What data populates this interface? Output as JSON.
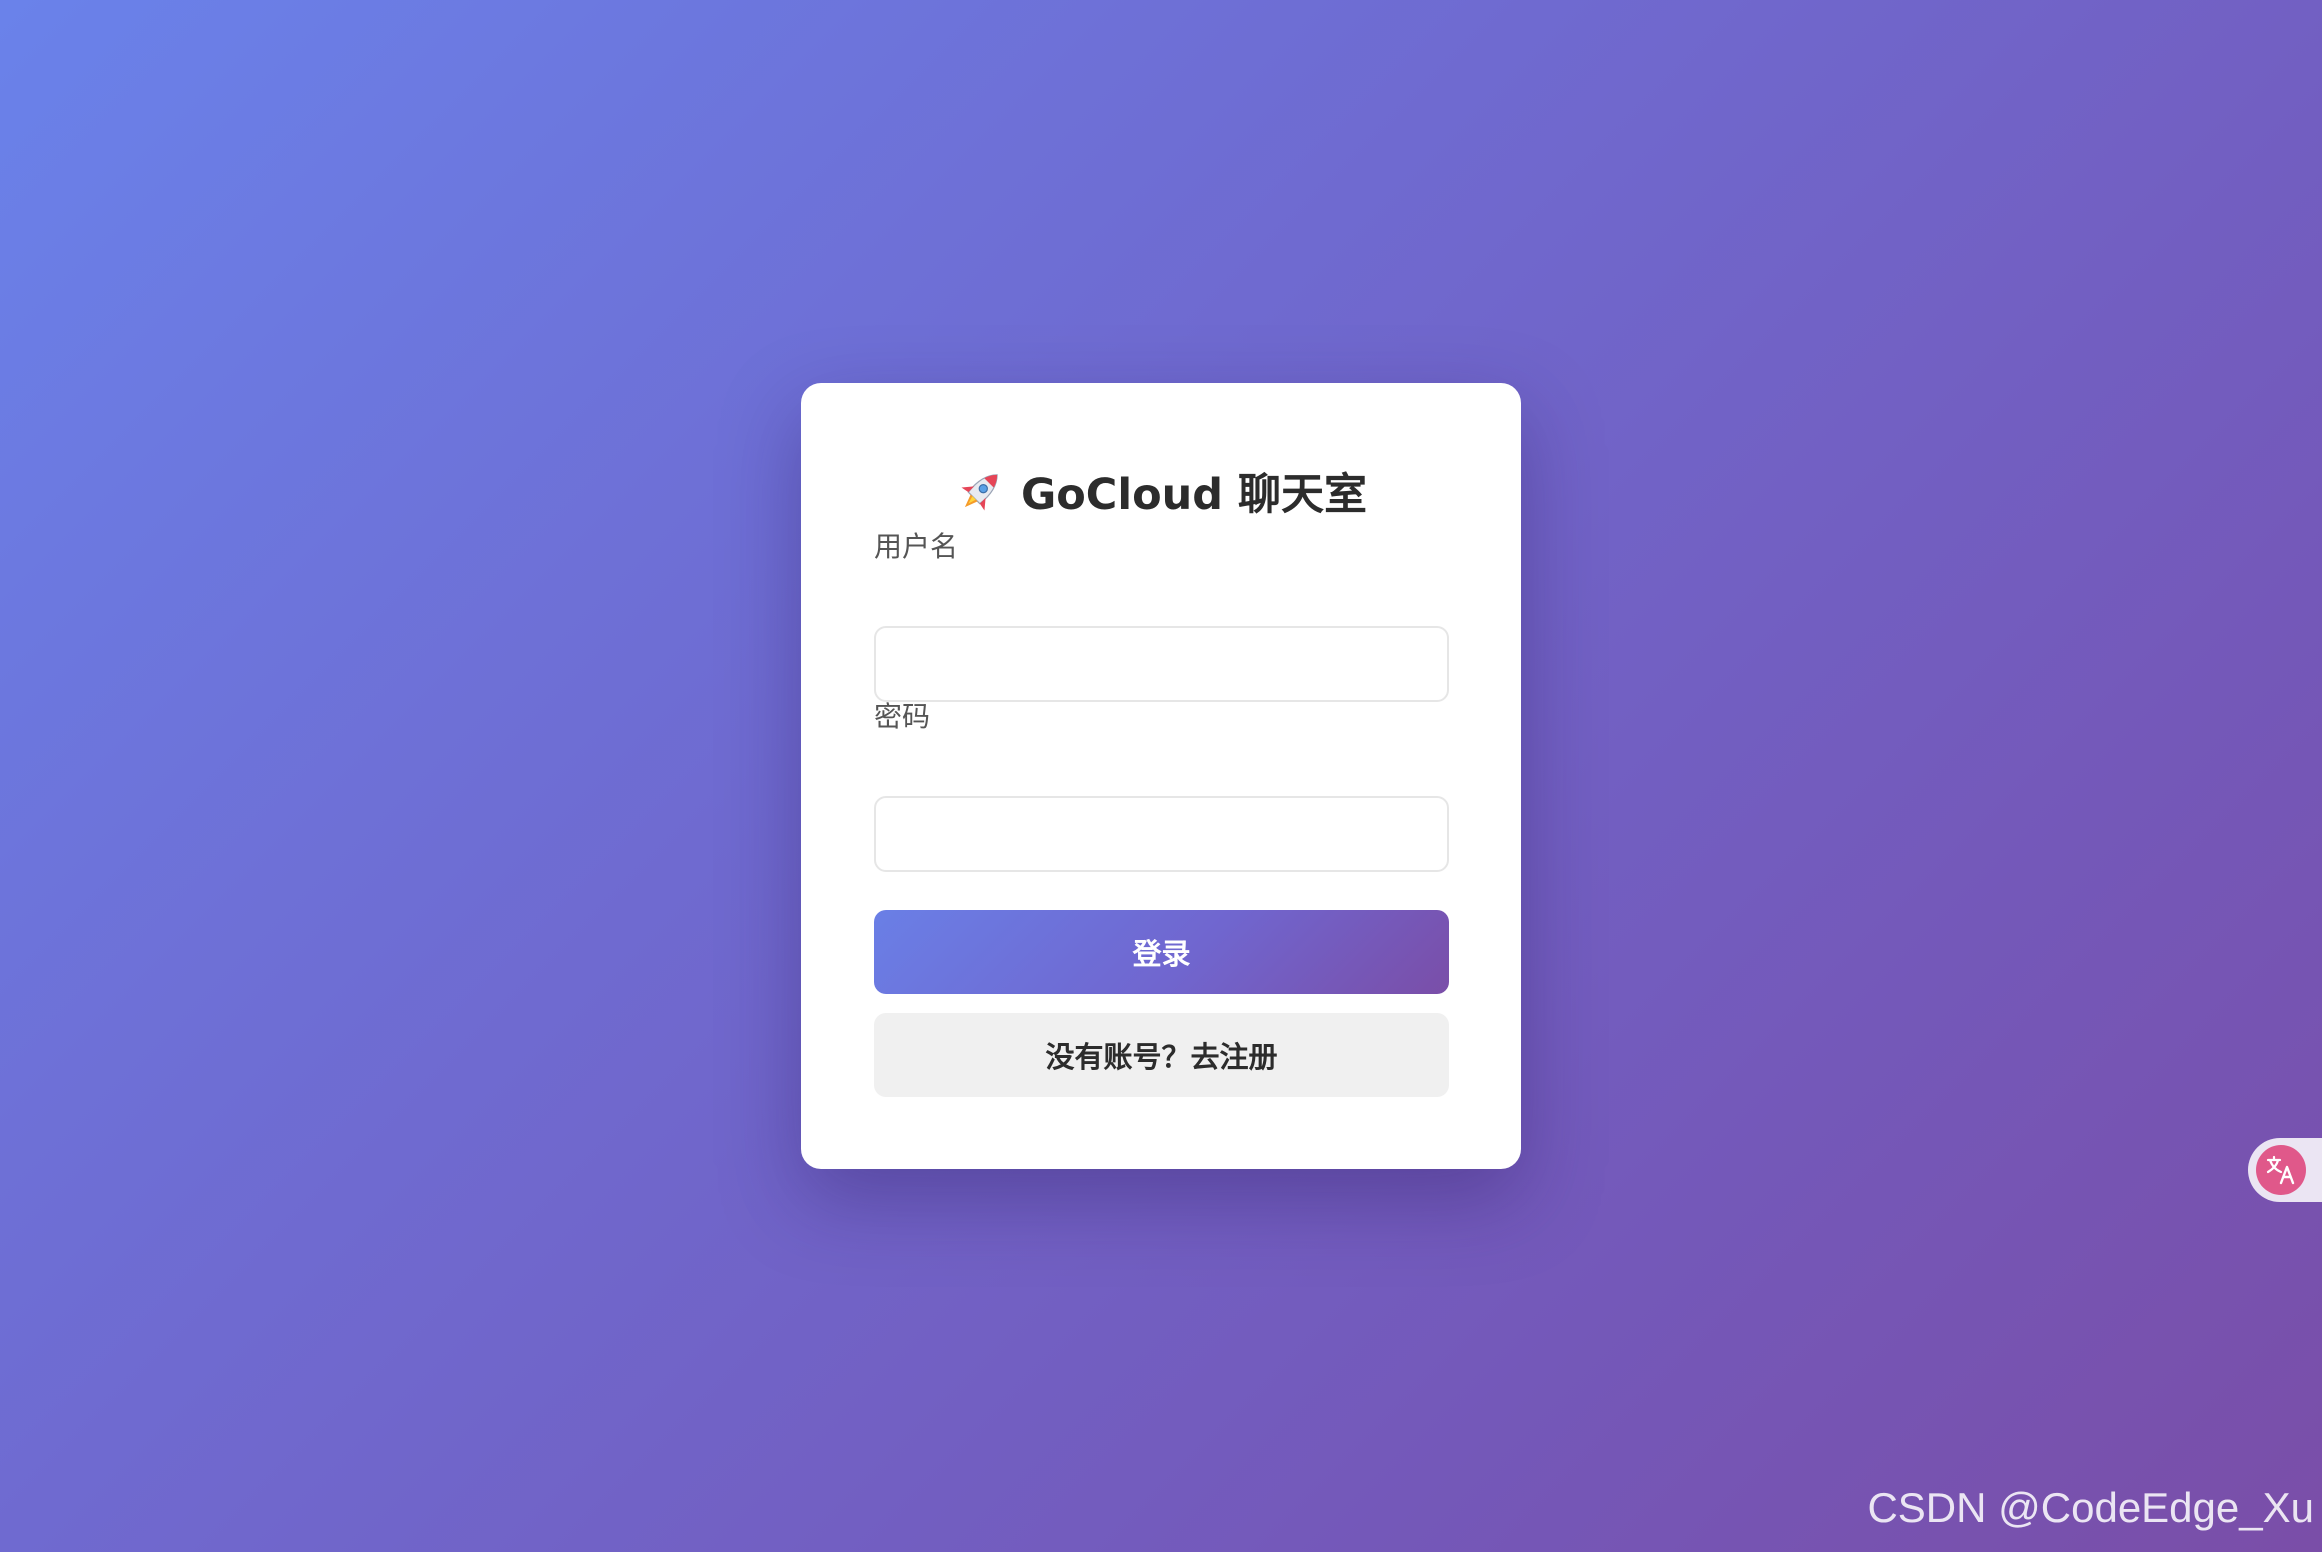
{
  "login_card": {
    "title": "GoCloud 聊天室",
    "title_icon": "rocket-icon",
    "username_label": "用户名",
    "username_value": "",
    "password_label": "密码",
    "password_value": "",
    "login_button": "登录",
    "register_button": "没有账号？去注册"
  },
  "translate_widget": {
    "icon": "translate-icon"
  },
  "watermark": "CSDN @CodeEdge_Xu",
  "colors": {
    "background_start": "#6a82ea",
    "background_end": "#7a4ea8",
    "primary_start": "#6a7fe6",
    "primary_end": "#7a4ea8",
    "secondary_button": "#f0f0f0"
  }
}
